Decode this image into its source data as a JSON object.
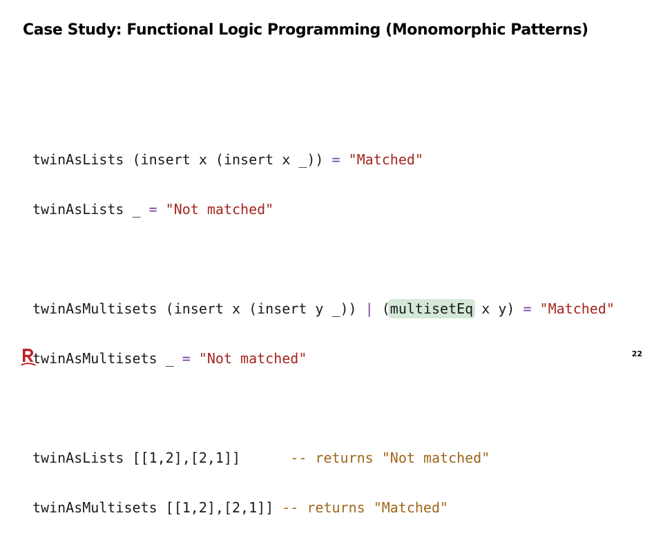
{
  "slide": {
    "title": "Case Study: Functional Logic Programming (Monomorphic Patterns)",
    "page_number": "22",
    "logo_icon": "r-logo-icon",
    "colors": {
      "keyword_operator": "#7a3e9d",
      "string": "#a3261f",
      "comment": "#a0661a",
      "highlight": "#d5e8d8",
      "logo": "#bf1e22"
    }
  },
  "code": {
    "l1": {
      "a": "twinAsLists (insert x (insert x _)) ",
      "op": "=",
      "b": " ",
      "str": "\"Matched\""
    },
    "l2": {
      "a": "twinAsLists _ ",
      "op": "=",
      "b": " ",
      "str": "\"Not matched\""
    },
    "l3": {
      "a": "twinAsMultisets (insert x (insert y _)) ",
      "op1": "|",
      "b": " (",
      "hl": "multisetEq",
      "c": " x y) ",
      "op2": "=",
      "d": " ",
      "str": "\"Matched\""
    },
    "l4": {
      "a": "twinAsMultisets _ ",
      "op": "=",
      "b": " ",
      "str": "\"Not matched\""
    },
    "l5": {
      "a": "twinAsLists [[1,2],[2,1]]      ",
      "cmt": "-- returns ",
      "str": "\"Not matched\""
    },
    "l6": {
      "a": "twinAsMultisets [[1,2],[2,1]] ",
      "cmt": "-- returns ",
      "str": "\"Matched\""
    }
  }
}
